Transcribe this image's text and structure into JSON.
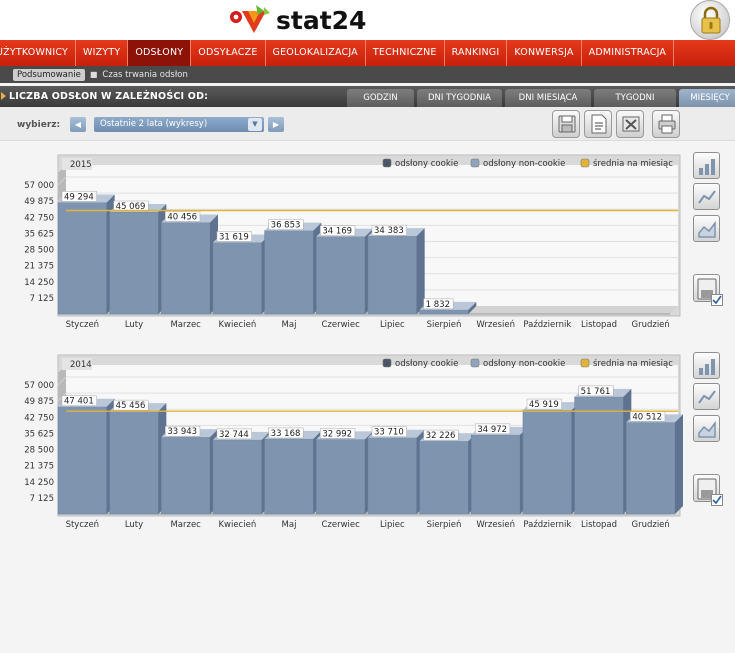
{
  "header": {
    "logo_text": "stat24"
  },
  "main_nav": [
    {
      "label": "UŻYTKOWNICY",
      "active": false
    },
    {
      "label": "WIZYTY",
      "active": false
    },
    {
      "label": "ODSŁONY",
      "active": true
    },
    {
      "label": "ODSYŁACZE",
      "active": false
    },
    {
      "label": "GEOLOKALIZACJA",
      "active": false
    },
    {
      "label": "TECHNICZNE",
      "active": false
    },
    {
      "label": "RANKINGI",
      "active": false
    },
    {
      "label": "KONWERSJA",
      "active": false
    },
    {
      "label": "ADMINISTRACJA",
      "active": false
    }
  ],
  "sub_nav": {
    "active": "Podsumowanie",
    "other": "Czas trwania odsłon"
  },
  "section": {
    "title": "LICZBA ODSŁON W ZALEŻNOŚCI OD:",
    "tabs": [
      {
        "label": "GODZIN",
        "active": false
      },
      {
        "label": "DNI TYGODNIA",
        "active": false
      },
      {
        "label": "DNI MIESIĄCA",
        "active": false
      },
      {
        "label": "TYGODNI",
        "active": false
      },
      {
        "label": "MIESIĘCY",
        "active": true
      }
    ]
  },
  "toolbar": {
    "label": "wybierz:",
    "selected": "Ostatnie 2 lata (wykresy)",
    "prev_icon": "arrow-left-icon",
    "next_icon": "arrow-right-icon",
    "export_icons": [
      "save-icon",
      "txt-export-icon",
      "excel-export-icon",
      "print-icon"
    ]
  },
  "colors": {
    "nav_red": "#d7260e",
    "bar": "#7f94af",
    "average": "#e2b23a",
    "cookie": "#4a5566",
    "noncookie": "#8fa3bd"
  },
  "chart_data": [
    {
      "type": "bar",
      "title": "2015",
      "legend": [
        "odsłony cookie",
        "odsłony non-cookie",
        "średnia na miesiąc"
      ],
      "legend_position": "top-right",
      "categories": [
        "Styczeń",
        "Luty",
        "Marzec",
        "Kwiecień",
        "Maj",
        "Czerwiec",
        "Lipiec",
        "Sierpień",
        "Wrzesień",
        "Październik",
        "Listopad",
        "Grudzień"
      ],
      "values": [
        49294,
        45069,
        40456,
        31619,
        36853,
        34169,
        34383,
        1832,
        null,
        null,
        null,
        null
      ],
      "value_labels": [
        "49 294",
        "45 069",
        "40 456",
        "31 619",
        "36 853",
        "34 169",
        "34 383",
        "1 832",
        "",
        "",
        "",
        ""
      ],
      "average": 42200,
      "yticks": [
        "57 000",
        "49 875",
        "42 750",
        "35 625",
        "28 500",
        "21 375",
        "14 250",
        "7 125"
      ],
      "ylim": [
        0,
        57000
      ],
      "grid": true
    },
    {
      "type": "bar",
      "title": "2014",
      "legend": [
        "odsłony cookie",
        "odsłony non-cookie",
        "średnia na miesiąc"
      ],
      "legend_position": "top-right",
      "categories": [
        "Styczeń",
        "Luty",
        "Marzec",
        "Kwiecień",
        "Maj",
        "Czerwiec",
        "Lipiec",
        "Sierpień",
        "Wrzesień",
        "Październik",
        "Listopad",
        "Grudzień"
      ],
      "values": [
        47401,
        45456,
        33943,
        32744,
        33168,
        32992,
        33710,
        32226,
        34972,
        45919,
        51761,
        40512
      ],
      "value_labels": [
        "47 401",
        "45 456",
        "33 943",
        "32 744",
        "33 168",
        "32 992",
        "33 710",
        "32 226",
        "34 972",
        "45 919",
        "51 761",
        "40 512"
      ],
      "average": 41900,
      "yticks": [
        "57 000",
        "49 875",
        "42 750",
        "35 625",
        "28 500",
        "21 375",
        "14 250",
        "7 125"
      ],
      "ylim": [
        0,
        57000
      ],
      "grid": true
    }
  ],
  "chart_side_buttons": [
    "bar-chart-icon",
    "line-chart-icon",
    "area-chart-icon",
    "save-chart-icon"
  ]
}
